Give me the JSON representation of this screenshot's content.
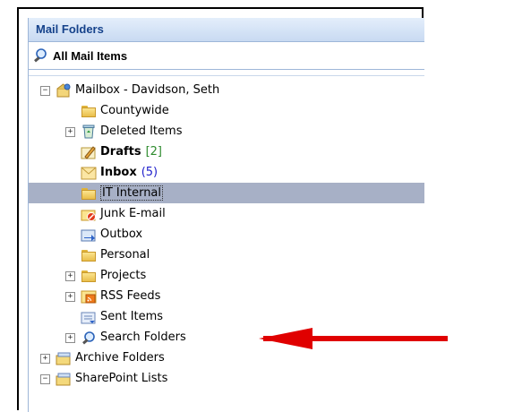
{
  "pane": {
    "title": "Mail Folders",
    "all_items_label": "All Mail Items"
  },
  "tree": {
    "mailbox": {
      "label": "Mailbox - Davidson, Seth",
      "expander": "−"
    },
    "items": [
      {
        "label": "Countywide"
      },
      {
        "label": "Deleted Items",
        "expander": "+"
      },
      {
        "label": "Drafts",
        "count": "[2]"
      },
      {
        "label": "Inbox",
        "count": "(5)"
      },
      {
        "label": "IT Internal"
      },
      {
        "label": "Junk E-mail"
      },
      {
        "label": "Outbox"
      },
      {
        "label": "Personal"
      },
      {
        "label": "Projects",
        "expander": "+"
      },
      {
        "label": "RSS Feeds",
        "expander": "+"
      },
      {
        "label": "Sent Items"
      },
      {
        "label": "Search Folders",
        "expander": "+"
      }
    ],
    "archive": {
      "label": "Archive Folders",
      "expander": "+"
    },
    "sharepoint": {
      "label": "SharePoint Lists",
      "expander": "−"
    }
  },
  "colors": {
    "header_text": "#15428b",
    "selection": "#a7b0c6",
    "drafts_count": "#2e8b2e",
    "inbox_count": "#2222cc",
    "arrow": "#e00000"
  },
  "icons": {
    "all_items": "search-magnifier-icon",
    "mailbox": "mailbox-icon",
    "folder": "folder-icon",
    "deleted": "recycle-bin-icon",
    "drafts": "drafts-pencil-icon",
    "inbox": "inbox-envelope-icon",
    "junk": "junk-mail-icon",
    "outbox": "outbox-icon",
    "rss": "rss-feed-icon",
    "sent": "sent-items-icon",
    "search_folders": "search-folder-icon",
    "archive": "archive-folder-icon",
    "sharepoint": "sharepoint-folder-icon"
  }
}
